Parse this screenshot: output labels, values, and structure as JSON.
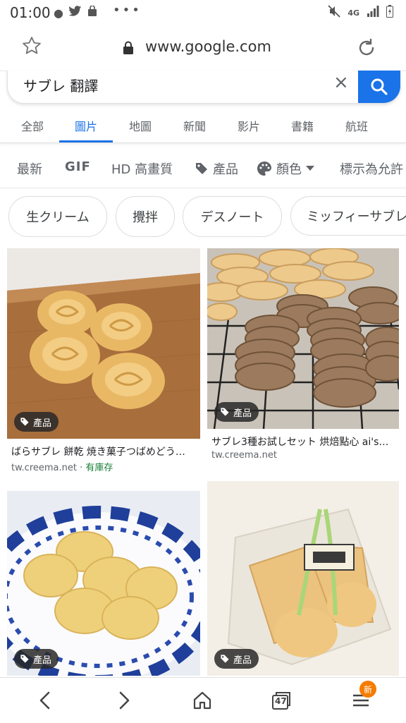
{
  "status": {
    "time": "01:00",
    "network": "4G"
  },
  "browser": {
    "url": "www.google.com"
  },
  "search": {
    "query": "サブレ 翻譯",
    "clear_symbol": "×"
  },
  "tabs": [
    {
      "label": "全部"
    },
    {
      "label": "圖片"
    },
    {
      "label": "地圖"
    },
    {
      "label": "新聞"
    },
    {
      "label": "影片"
    },
    {
      "label": "書籍"
    },
    {
      "label": "航班"
    }
  ],
  "filters": {
    "latest": "最新",
    "gif": "GIF",
    "hd": "HD 高畫質",
    "product": "產品",
    "color": "顏色",
    "license": "標示為允許"
  },
  "chips": [
    "生クリーム",
    "攪拌",
    "デスノート",
    "ミッフィーサブレ"
  ],
  "results": [
    {
      "badge": "產品",
      "title": "ばらサブレ 餅乾 焼き菓子つばめどう…",
      "source": "tw.creema.net",
      "stock": "有庫存"
    },
    {
      "badge": "產品",
      "title": "サブレ3種お試しセット 烘焙點心 ai's…",
      "source": "tw.creema.net"
    },
    {
      "badge": "產品"
    },
    {
      "badge": "產品"
    }
  ],
  "bottom_nav": {
    "tab_count": "47",
    "new_badge": "新"
  }
}
